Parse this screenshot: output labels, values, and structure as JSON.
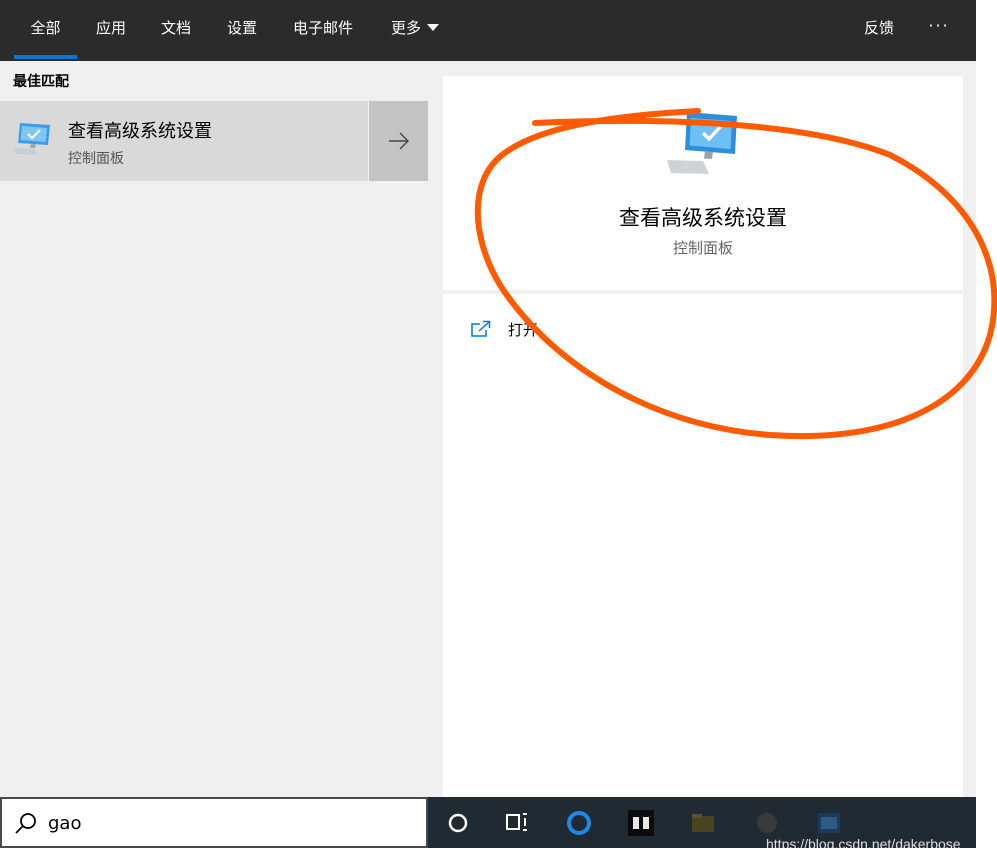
{
  "tabs": [
    {
      "label": "全部",
      "active": true
    },
    {
      "label": "应用"
    },
    {
      "label": "文档"
    },
    {
      "label": "设置"
    },
    {
      "label": "电子邮件"
    },
    {
      "label": "更多"
    }
  ],
  "topbar": {
    "feedback_label": "反馈",
    "more_options_label": "···"
  },
  "best_match": {
    "heading": "最佳匹配",
    "title": "查看高级系统设置",
    "subtitle": "控制面板",
    "icon": "computer-monitor-icon"
  },
  "detail": {
    "title": "查看高级系统设置",
    "subtitle": "控制面板",
    "icon": "computer-monitor-icon",
    "open_label": "打开"
  },
  "search": {
    "value": "gao",
    "placeholder": ""
  },
  "watermark": "https://blog.csdn.net/dakerbose",
  "colors": {
    "accent": "#0078d7",
    "topbar": "#2b2b2b",
    "annotation": "#ff5a00",
    "taskbar": "#1f2a32"
  }
}
